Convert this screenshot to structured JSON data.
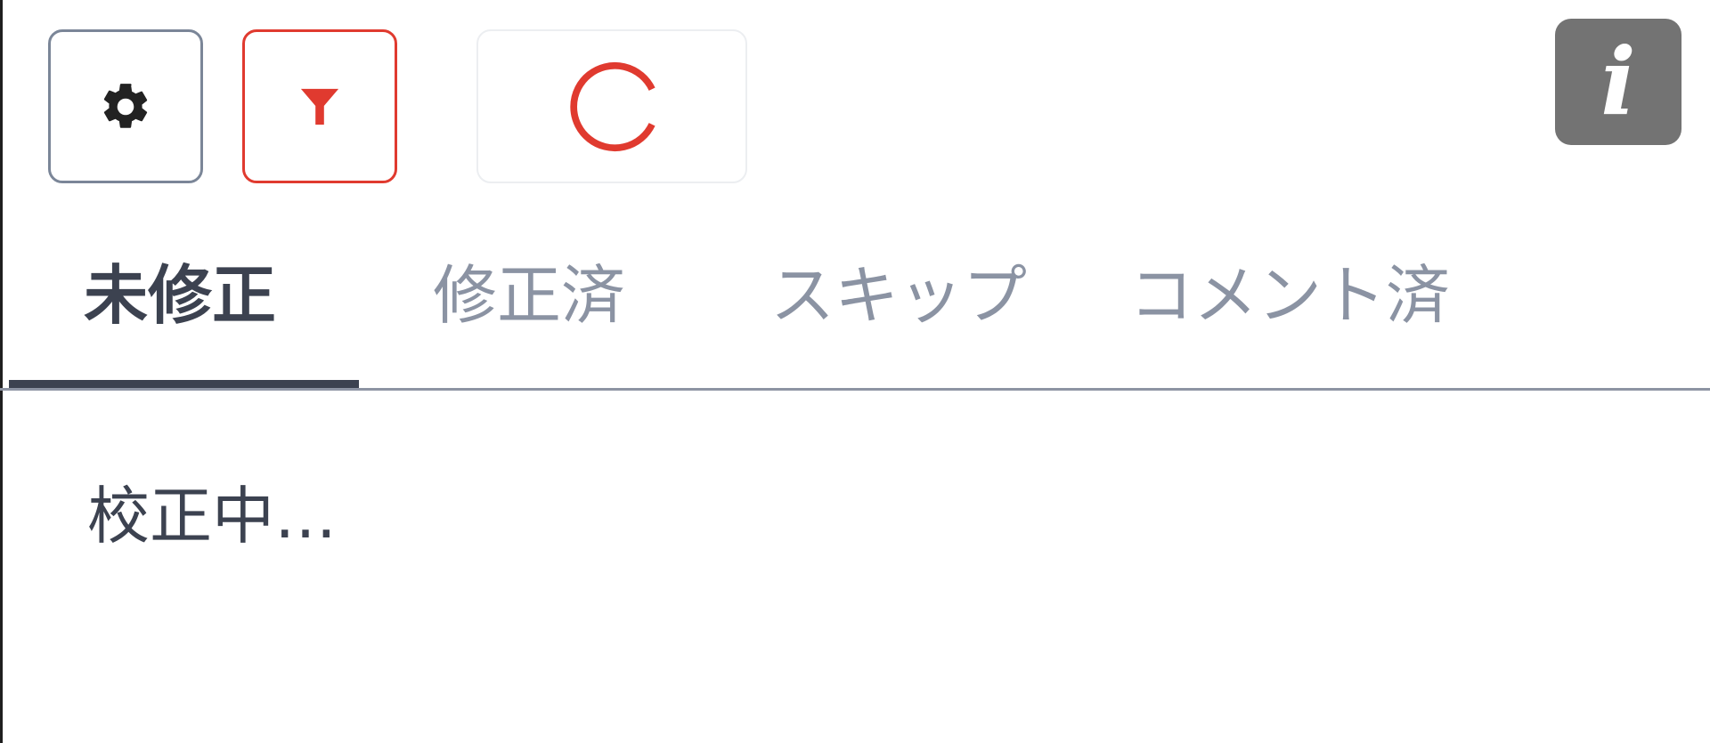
{
  "toolbar": {
    "settings_icon": "gear-icon",
    "filter_icon": "filter-icon",
    "refresh_icon": "refresh-icon",
    "info_icon": "info-icon",
    "info_glyph": "i",
    "colors": {
      "accent": "#e03a2f",
      "border_neutral": "#7b8698",
      "info_bg": "#737373"
    }
  },
  "tabs": [
    {
      "label": "未修正",
      "active": true
    },
    {
      "label": "修正済",
      "active": false
    },
    {
      "label": "スキップ",
      "active": false
    },
    {
      "label": "コメント済",
      "active": false
    }
  ],
  "content": {
    "status": "校正中…"
  }
}
